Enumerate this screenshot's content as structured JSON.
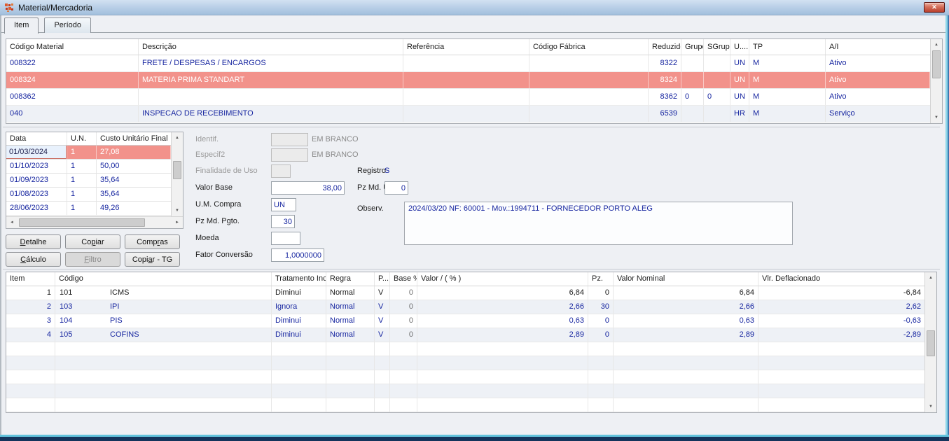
{
  "window": {
    "title": "Material/Mercadoria",
    "close_glyph": "✕"
  },
  "tabs": {
    "item": "Item",
    "periodo": "Período"
  },
  "materials": {
    "headers": {
      "codigo": "Código Material",
      "descricao": "Descrição",
      "referencia": "Referência",
      "codigo_fabrica": "Código Fábrica",
      "reduzido": "Reduzido",
      "grupo": "Grupo",
      "sgrupo": "SGrupo",
      "u": "U....",
      "tp": "TP",
      "ai": "A/I"
    },
    "rows": [
      {
        "codigo": "008322",
        "descricao": "FRETE / DESPESAS / ENCARGOS",
        "referencia": "",
        "codigo_fabrica": "",
        "reduzido": "8322",
        "grupo": "",
        "sgrupo": "",
        "u": "UN",
        "tp": "M",
        "ai": "Ativo"
      },
      {
        "codigo": "008324",
        "descricao": "MATERIA PRIMA STANDART",
        "referencia": "",
        "codigo_fabrica": "",
        "reduzido": "8324",
        "grupo": "",
        "sgrupo": "",
        "u": "UN",
        "tp": "M",
        "ai": "Ativo"
      },
      {
        "codigo": "008362",
        "descricao": "",
        "referencia": "",
        "codigo_fabrica": "",
        "reduzido": "8362",
        "grupo": "0",
        "sgrupo": "0",
        "u": "UN",
        "tp": "M",
        "ai": "Ativo"
      },
      {
        "codigo": "040",
        "descricao": "INSPECAO DE RECEBIMENTO",
        "referencia": "",
        "codigo_fabrica": "",
        "reduzido": "6539",
        "grupo": "",
        "sgrupo": "",
        "u": "HR",
        "tp": "M",
        "ai": "Serviço"
      }
    ]
  },
  "costs": {
    "headers": {
      "data": "Data",
      "un": "U.N.",
      "custo": "Custo Unitário Final"
    },
    "rows": [
      {
        "data": "01/03/2024",
        "un": "1",
        "custo": "27,08"
      },
      {
        "data": "01/10/2023",
        "un": "1",
        "custo": "50,00"
      },
      {
        "data": "01/09/2023",
        "un": "1",
        "custo": "35,64"
      },
      {
        "data": "01/08/2023",
        "un": "1",
        "custo": "35,64"
      },
      {
        "data": "28/06/2023",
        "un": "1",
        "custo": "49,26"
      }
    ]
  },
  "buttons": {
    "detalhe": {
      "pre": "",
      "u": "D",
      "post": "etalhe"
    },
    "copiar": {
      "pre": "Co",
      "u": "p",
      "post": "iar"
    },
    "compras": {
      "pre": "Comp",
      "u": "r",
      "post": "as"
    },
    "calculo": {
      "pre": "",
      "u": "C",
      "post": "álculo"
    },
    "filtro": {
      "pre": "",
      "u": "F",
      "post": "iltro"
    },
    "copiar_tg": {
      "pre": "Copi",
      "u": "a",
      "post": "r - TG"
    }
  },
  "form": {
    "identif": {
      "label": "Identif.",
      "value": "",
      "hint": "EM BRANCO"
    },
    "especif2": {
      "label": "Especif2",
      "value": "",
      "hint": "EM BRANCO"
    },
    "finalidade": {
      "label": "Finalidade de Uso",
      "value": ""
    },
    "valor_base": {
      "label": "Valor Base",
      "value": "38,00"
    },
    "um_compra": {
      "label": "U.M. Compra",
      "value": "UN"
    },
    "pz_md_pgto": {
      "label": "Pz Md. Pgto.",
      "value": "30"
    },
    "moeda": {
      "label": "Moeda",
      "value": ""
    },
    "fator_conversao": {
      "label": "Fator Conversão",
      "value": "1,0000000"
    },
    "registro": {
      "label": "Registro",
      "value": "S"
    },
    "pz_md_uso": {
      "label": "Pz Md. Uso",
      "value": "0"
    },
    "observ": {
      "label": "Observ.",
      "value": "2024/03/20 NF: 60001 -  Mov.:1994711 - FORNECEDOR PORTO ALEG"
    }
  },
  "taxes": {
    "headers": {
      "item": "Item",
      "codigo": "Código",
      "tratamento": "Tratamento Inc.",
      "regra": "Regra",
      "p": "P...",
      "base": "Base %",
      "valor": "Valor / ( % )",
      "pz": "Pz.",
      "nominal": "Valor Nominal",
      "deflacionado": "Vlr. Deflacionado"
    },
    "rows": [
      {
        "item": "1",
        "codigo": "101",
        "nome": "ICMS",
        "tratamento": "Diminui",
        "regra": "Normal",
        "p": "V",
        "base": "0",
        "valor": "6,84",
        "pz": "0",
        "nominal": "6,84",
        "deflacionado": "-6,84"
      },
      {
        "item": "2",
        "codigo": "103",
        "nome": "IPI",
        "tratamento": "Ignora",
        "regra": "Normal",
        "p": "V",
        "base": "0",
        "valor": "2,66",
        "pz": "30",
        "nominal": "2,66",
        "deflacionado": "2,62"
      },
      {
        "item": "3",
        "codigo": "104",
        "nome": "PIS",
        "tratamento": "Diminui",
        "regra": "Normal",
        "p": "V",
        "base": "0",
        "valor": "0,63",
        "pz": "0",
        "nominal": "0,63",
        "deflacionado": "-0,63"
      },
      {
        "item": "4",
        "codigo": "105",
        "nome": "COFINS",
        "tratamento": "Diminui",
        "regra": "Normal",
        "p": "V",
        "base": "0",
        "valor": "2,89",
        "pz": "0",
        "nominal": "2,89",
        "deflacionado": "-2,89"
      }
    ]
  },
  "colors": {
    "selection_pink": "#f2928b",
    "data_navy": "#1726a0",
    "titlebar_blue": "#b6cde6",
    "close_button_red": "#b93f2c",
    "window_border_cyan": "#62c3dc",
    "window_border_navy": "#14345c"
  }
}
